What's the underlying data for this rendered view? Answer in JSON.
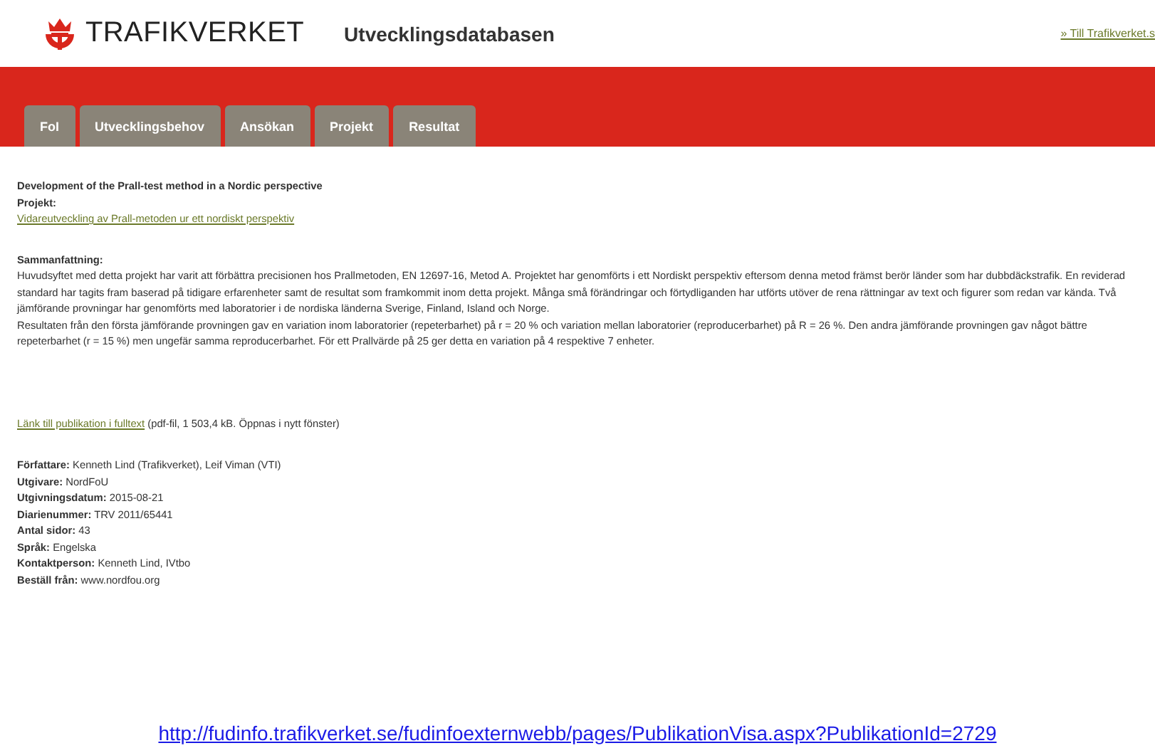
{
  "header": {
    "brand": "TRAFIKVERKET",
    "site_title": "Utvecklingsdatabasen",
    "top_link": "» Till Trafikverket.s"
  },
  "tabs": [
    {
      "label": "FoI",
      "selected": false
    },
    {
      "label": "Utvecklingsbehov",
      "selected": false
    },
    {
      "label": "Ansökan",
      "selected": false
    },
    {
      "label": "Projekt",
      "selected": false
    },
    {
      "label": "Resultat",
      "selected": false
    }
  ],
  "publication": {
    "title": "Development of the Prall-test method in a Nordic perspective",
    "project_label": "Projekt:",
    "project_link": "Vidareutveckling av Prall-metoden ur ett nordiskt perspektiv",
    "summary_label": "Sammanfattning:",
    "summary": [
      "Huvudsyftet med detta projekt har varit att förbättra precisionen hos Prallmetoden, EN 12697-16, Metod A. Projektet har genomförts i ett Nordiskt perspektiv eftersom denna metod främst berör länder som har dubbdäckstrafik. En reviderad standard har tagits fram baserad på tidigare erfarenheter samt de resultat som framkommit inom detta projekt. Många små förändringar och förtydliganden har utförts utöver de rena rättningar av text och figurer som redan var kända. Två jämförande provningar har genomförts med laboratorier i de nordiska länderna Sverige, Finland, Island och Norge.",
      "Resultaten från den första jämförande provningen gav en variation inom laboratorier (repeterbarhet) på r = 20 % och variation mellan laboratorier (reproducerbarhet) på R = 26 %. Den andra jämförande provningen gav något bättre repeterbarhet (r = 15 %) men ungefär samma reproducerbarhet. För ett Prallvärde på 25 ger detta en variation på 4 respektive 7 enheter."
    ],
    "fulltext_link": "Länk till publikation i fulltext",
    "fulltext_note": "(pdf-fil, 1 503,4 kB. Öppnas i nytt fönster)",
    "details": [
      {
        "label": "Författare:",
        "value": "Kenneth Lind (Trafikverket), Leif Viman (VTI)"
      },
      {
        "label": "Utgivare:",
        "value": "NordFoU"
      },
      {
        "label": "Utgivningsdatum:",
        "value": "2015-08-21"
      },
      {
        "label": "Diarienummer:",
        "value": "TRV 2011/65441"
      },
      {
        "label": "Antal sidor:",
        "value": "43"
      },
      {
        "label": "Språk:",
        "value": "Engelska"
      },
      {
        "label": "Kontaktperson:",
        "value": "Kenneth Lind, IVtbo"
      },
      {
        "label": "Beställ från:",
        "value": "www.nordfou.org"
      }
    ]
  },
  "source_url": "http://fudinfo.trafikverket.se/fudinfoexternwebb/pages/PublikationVisa.aspx?PublikationId=2729"
}
